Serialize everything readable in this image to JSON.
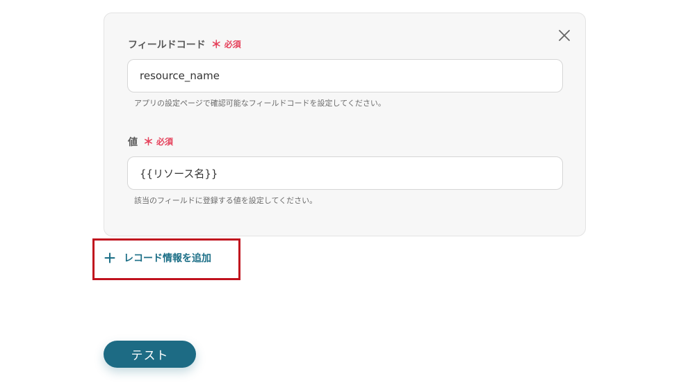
{
  "form": {
    "field_code": {
      "label": "フィールドコード",
      "required_star": "＊",
      "required_text": "必須",
      "value": "resource_name",
      "help": "アプリの設定ページで確認可能なフィールドコードを設定してください。"
    },
    "value_field": {
      "label": "値",
      "required_star": "＊",
      "required_text": "必須",
      "value": "{{リソース名}}",
      "help": "該当のフィールドに登録する値を設定してください。"
    },
    "close_icon": "close-icon"
  },
  "add_record": {
    "icon": "plus-icon",
    "label": "レコード情報を追加"
  },
  "test_button": {
    "label": "テスト"
  },
  "colors": {
    "accent": "#1d6b84",
    "required": "#e5415b",
    "highlight_border": "#c0121e",
    "card_bg": "#f7f7f7"
  }
}
